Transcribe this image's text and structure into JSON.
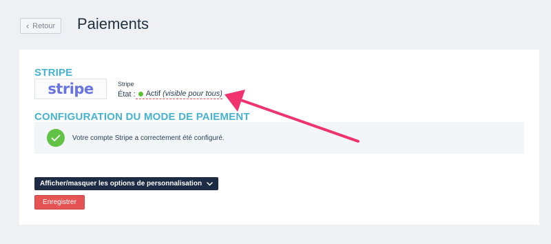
{
  "header": {
    "back_label": "Retour",
    "title": "Paiements"
  },
  "stripe_section": {
    "title": "STRIPE",
    "logo_text": "stripe",
    "provider_name": "Stripe",
    "state_label": "État :",
    "state_value": "Actif",
    "state_detail": "(visible pour tous)",
    "status_color": "#5bc236"
  },
  "config_section": {
    "title": "CONFIGURATION DU MODE DE PAIEMENT",
    "success_message": "Votre compte Stripe a correctement été configuré."
  },
  "actions": {
    "toggle_options_label": "Afficher/masquer les options de personnalisation",
    "save_label": "Enregistrer"
  },
  "colors": {
    "accent": "#45b3d0",
    "primary_dark": "#1d2b44",
    "danger": "#e55353",
    "success": "#62c246",
    "annotation_arrow": "#f0326e"
  },
  "icons": {
    "back": "chevron-left-icon",
    "toggle": "chevron-down-icon",
    "success": "check-circle-icon",
    "annotation": "arrow-icon"
  }
}
